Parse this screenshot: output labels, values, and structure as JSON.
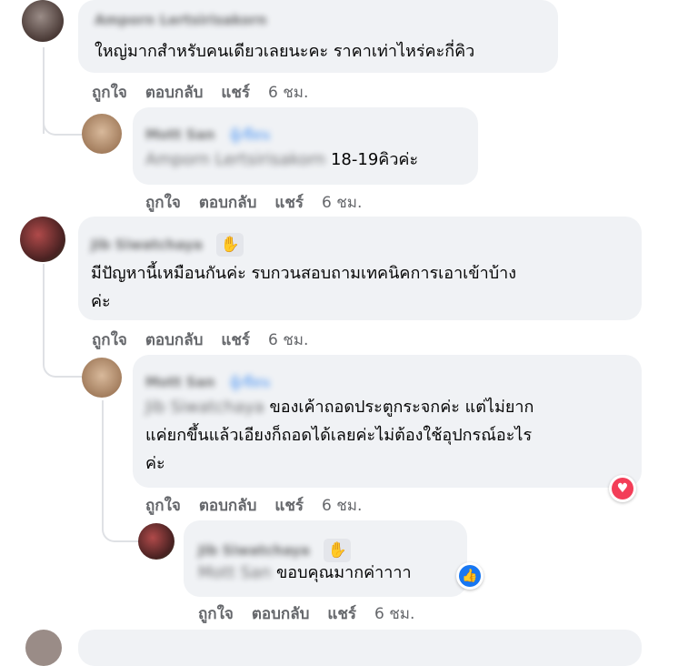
{
  "actions": {
    "like": "ถูกใจ",
    "reply": "ตอบกลับ",
    "share": "แชร์",
    "time": "6 ชม."
  },
  "comments": [
    {
      "name": "Amporn Lertsirisakorn",
      "text": "ใหญ่มากสำหรับคนเดียวเลยนะคะ ราคาเท่าไหร่คะกี่คิว"
    },
    {
      "name": "Mott San",
      "tag": "ผู้เขียน",
      "mention": "Amporn Lertsirisakorn",
      "text": "18-19คิวค่ะ"
    },
    {
      "name": "Jib Siwatchaya",
      "badge_icon": "waving-hand-icon",
      "lines": [
        "มีปัญหานี้เหมือนกันค่ะ รบกวนสอบถามเทคนิคการเอาเข้าบ้าง",
        "ค่ะ"
      ]
    },
    {
      "name": "Mott San",
      "tag": "ผู้เขียน",
      "mention": "Jib Siwatchaya",
      "lines": [
        "ของเค้าถอดประตูกระจกค่ะ แต่ไม่ยาก",
        "แค่ยกขึ้นแล้วเอียงก็ถอดได้เลยค่ะไม่ต้องใช้อุปกรณ์อะไร",
        "ค่ะ"
      ],
      "reaction": "heart-reaction-icon"
    },
    {
      "name": "Jib Siwatchaya",
      "name_visible_tail": "haya",
      "badge_icon": "waving-hand-icon",
      "mention": "Mott San",
      "text": "ขอบคุณมากค่าาาา",
      "reaction": "like-reaction-icon"
    }
  ],
  "colors": {
    "bubble": "#f0f2f5",
    "meta": "#65676b",
    "heart": "#f33e58",
    "like": "#1877f2"
  }
}
